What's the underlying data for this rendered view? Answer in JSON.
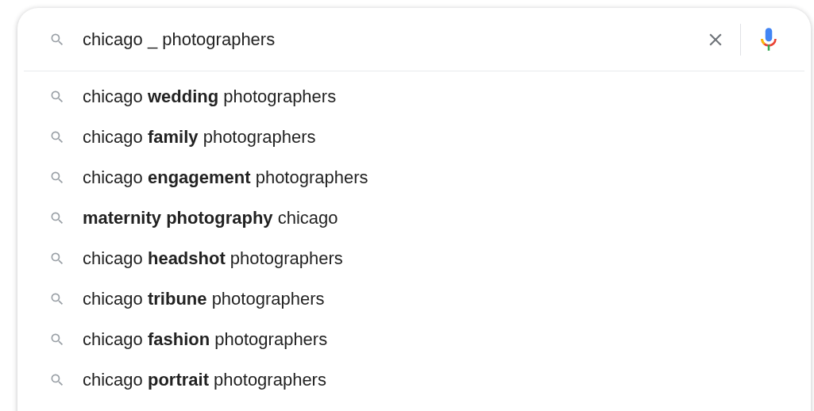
{
  "search": {
    "value": "chicago _ photographers"
  },
  "suggestions": [
    {
      "text": "chicago **wedding** photographers"
    },
    {
      "text": "chicago **family** photographers"
    },
    {
      "text": "chicago **engagement** photographers"
    },
    {
      "text": "**maternity photography** chicago"
    },
    {
      "text": "chicago **headshot** photographers"
    },
    {
      "text": "chicago **tribune** photographers"
    },
    {
      "text": "chicago **fashion** photographers"
    },
    {
      "text": "chicago **portrait** photographers"
    }
  ]
}
